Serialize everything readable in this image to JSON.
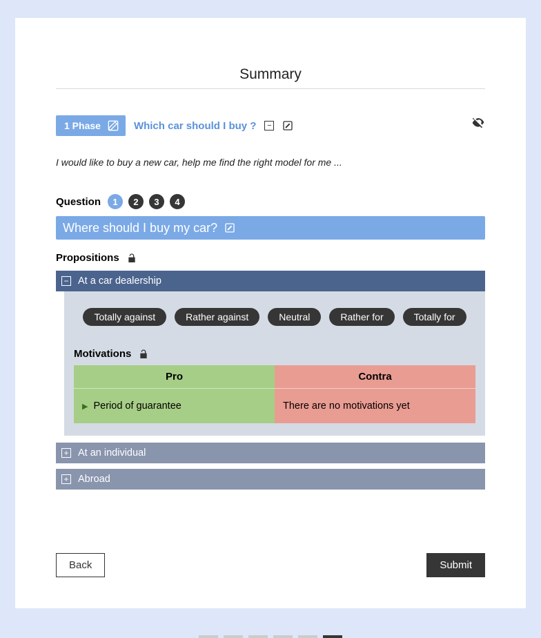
{
  "page_title": "Summary",
  "phase": {
    "badge_label": "1 Phase",
    "question_title": "Which car should I buy ?"
  },
  "description": "I would like to buy a new car, help me find the right model for me ...",
  "question": {
    "label": "Question",
    "numbers": [
      "1",
      "2",
      "3",
      "4"
    ],
    "active_index": 0,
    "text": "Where should I buy my car?"
  },
  "propositions": {
    "label": "Propositions",
    "items": [
      {
        "title": "At a car dealership",
        "expanded": true
      },
      {
        "title": "At an individual",
        "expanded": false
      },
      {
        "title": "Abroad",
        "expanded": false
      }
    ]
  },
  "stance_chips": [
    "Totally against",
    "Rather against",
    "Neutral",
    "Rather for",
    "Totally for"
  ],
  "motivations": {
    "label": "Motivations",
    "pro_header": "Pro",
    "contra_header": "Contra",
    "pro_items": [
      "Period of guarantee"
    ],
    "contra_empty_text": "There are no motivations yet"
  },
  "buttons": {
    "back": "Back",
    "submit": "Submit"
  },
  "pager": {
    "count": 6,
    "active_index": 5
  }
}
